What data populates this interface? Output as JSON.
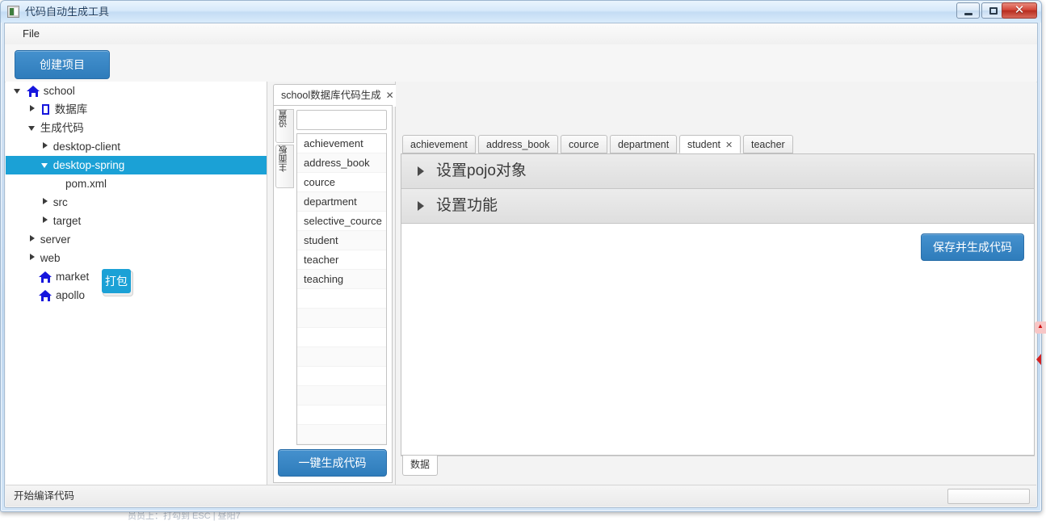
{
  "window": {
    "title": "代码自动生成工具",
    "icon": "app-icon",
    "controls": {
      "minimize": "minimize-icon",
      "maximize": "maximize-icon",
      "close": "✕"
    }
  },
  "menubar": {
    "items": [
      "File"
    ]
  },
  "toolbar": {
    "create_project_label": "创建项目"
  },
  "tree": {
    "nodes": [
      {
        "label": "school",
        "indent": 0,
        "arrow": "down",
        "icon": "home-icon",
        "selected": false
      },
      {
        "label": "数据库",
        "indent": 1,
        "arrow": "right",
        "icon": "square-icon",
        "selected": false
      },
      {
        "label": "生成代码",
        "indent": 1,
        "arrow": "down",
        "icon": "none",
        "selected": false
      },
      {
        "label": "desktop-client",
        "indent": 2,
        "arrow": "right",
        "icon": "none",
        "selected": false
      },
      {
        "label": "desktop-spring",
        "indent": 2,
        "arrow": "down",
        "icon": "none",
        "selected": true
      },
      {
        "label": "pom.xml",
        "indent": 3,
        "arrow": "none",
        "icon": "none",
        "selected": false
      },
      {
        "label": "src",
        "indent": 2,
        "arrow": "right",
        "icon": "none",
        "selected": false
      },
      {
        "label": "target",
        "indent": 2,
        "arrow": "right",
        "icon": "none",
        "selected": false
      },
      {
        "label": "server",
        "indent": 1,
        "arrow": "right",
        "icon": "none",
        "selected": false
      },
      {
        "label": "web",
        "indent": 1,
        "arrow": "right",
        "icon": "none",
        "selected": false
      },
      {
        "label": "market",
        "indent": 1,
        "arrow": "none",
        "icon": "home-icon",
        "selected": false
      },
      {
        "label": "apollo",
        "indent": 1,
        "arrow": "none",
        "icon": "home-icon",
        "selected": false
      }
    ]
  },
  "tooltip": {
    "text": "打包"
  },
  "db_panel": {
    "tab_label": "school数据库代码生成",
    "tab_close": "✕",
    "side_tabs": [
      {
        "label": "设置"
      },
      {
        "label": "主面板"
      }
    ],
    "filter_value": "",
    "filter_placeholder": "",
    "tables": [
      "achievement",
      "address_book",
      "cource",
      "department",
      "selective_cource",
      "student",
      "teacher",
      "teaching"
    ],
    "generate_all_label": "一键生成代码"
  },
  "entity_panel": {
    "tabs": [
      {
        "label": "achievement",
        "active": false,
        "closable": false
      },
      {
        "label": "address_book",
        "active": false,
        "closable": false
      },
      {
        "label": "cource",
        "active": false,
        "closable": false
      },
      {
        "label": "department",
        "active": false,
        "closable": false
      },
      {
        "label": "student",
        "active": true,
        "closable": true,
        "close": "✕"
      },
      {
        "label": "teacher",
        "active": false,
        "closable": false
      }
    ],
    "accordions": [
      {
        "title": "设置pojo对象",
        "expanded": false
      },
      {
        "title": "设置功能",
        "expanded": false
      }
    ],
    "save_generate_label": "保存并生成代码",
    "bottom_tab_label": "数据"
  },
  "statusbar": {
    "message": "开始编译代码",
    "progress_value": ""
  },
  "background": {
    "partial_text": "员员上：打勾到 ESC | 昼阳7"
  },
  "colors": {
    "accent_blue": "#2e7cbb",
    "selection_blue": "#1ba1d6",
    "tree_icon_blue": "#1616dd",
    "title_text": "#1b3a5c",
    "close_red": "#b72d1f"
  }
}
